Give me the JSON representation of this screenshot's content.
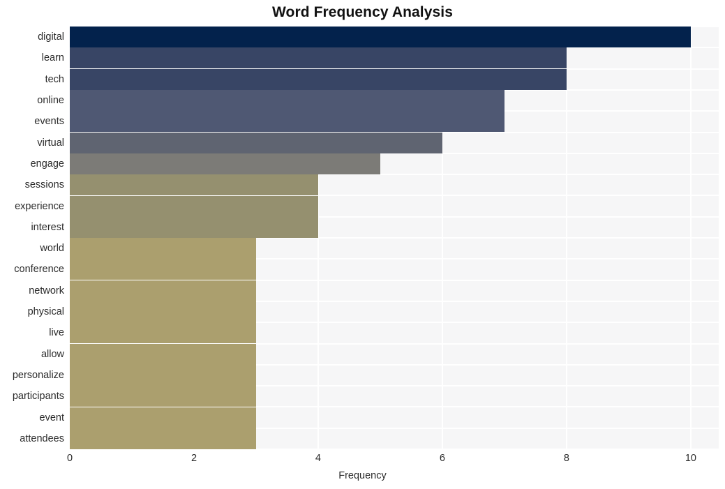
{
  "chart_data": {
    "type": "bar",
    "orientation": "horizontal",
    "title": "Word Frequency Analysis",
    "xlabel": "Frequency",
    "ylabel": "",
    "xlim": [
      0,
      10.45
    ],
    "xticks": [
      0,
      2,
      4,
      6,
      8,
      10
    ],
    "xtick_labels": [
      "0",
      "2",
      "4",
      "6",
      "8",
      "10"
    ],
    "grid": true,
    "grid_color": "#ffffff",
    "plot_background": "#f6f6f7",
    "legend": null,
    "categories": [
      "digital",
      "learn",
      "tech",
      "online",
      "events",
      "virtual",
      "engage",
      "sessions",
      "experience",
      "interest",
      "world",
      "conference",
      "network",
      "physical",
      "live",
      "allow",
      "personalize",
      "participants",
      "event",
      "attendees"
    ],
    "values": [
      10,
      8,
      8,
      7,
      7,
      6,
      5,
      4,
      4,
      4,
      3,
      3,
      3,
      3,
      3,
      3,
      3,
      3,
      3,
      3
    ],
    "bar_colors": [
      "#03224c",
      "#384565",
      "#384565",
      "#4f5873",
      "#4f5873",
      "#5f6471",
      "#7c7b77",
      "#95906f",
      "#95906f",
      "#95906f",
      "#ab9f6e",
      "#ab9f6e",
      "#ab9f6e",
      "#ab9f6e",
      "#ab9f6e",
      "#ab9f6e",
      "#ab9f6e",
      "#ab9f6e",
      "#ab9f6e",
      "#ab9f6e"
    ]
  }
}
